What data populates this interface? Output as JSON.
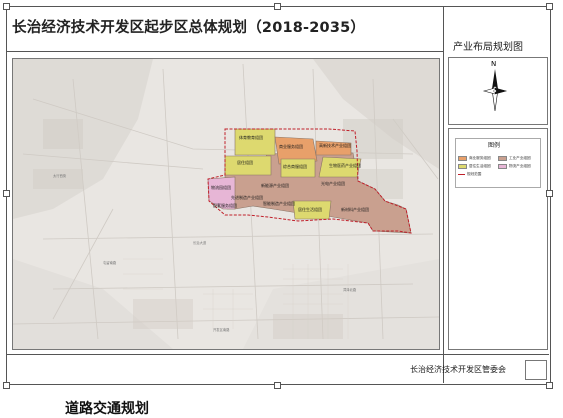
{
  "header": {
    "title": "长治经济技术开发区起步区总体规划（2018-2035）",
    "subtitle": "产业布局规划图"
  },
  "compass": {
    "north_label": "N",
    "icon": "north-arrow-icon"
  },
  "legend": {
    "title": "图例",
    "items": [
      {
        "label": "商业服务组团",
        "color": "#e8a06a"
      },
      {
        "label": "工业产业组团",
        "color": "#c9a08f"
      },
      {
        "label": "居住生活组团",
        "color": "#ddd96f"
      },
      {
        "label": "物流产业组团",
        "color": "#e7b6d6"
      },
      {
        "label": "规划范围",
        "color": "#c0202a",
        "style": "line"
      }
    ]
  },
  "map": {
    "zones": [
      {
        "label": "体育教育组团",
        "color": "#ddd96f"
      },
      {
        "label": "商业服务组团",
        "color": "#e8a06a"
      },
      {
        "label": "综合商服组团",
        "color": "#ddd96f"
      },
      {
        "label": "居住组团",
        "color": "#ddd96f"
      },
      {
        "label": "居住生活组团",
        "color": "#ddd96f"
      },
      {
        "label": "物流园组团",
        "color": "#e7b6d6"
      },
      {
        "label": "先进制造产业组团",
        "color": "#c9a08f"
      },
      {
        "label": "新能源产业组团",
        "color": "#c9a08f"
      },
      {
        "label": "光电产业组团",
        "color": "#c9a08f"
      },
      {
        "label": "智能制造产业组团",
        "color": "#c9a08f"
      },
      {
        "label": "新材料产业组团",
        "color": "#c9a08f"
      },
      {
        "label": "生物医药产业组团",
        "color": "#c9a08f"
      },
      {
        "label": "高新技术产业组团",
        "color": "#c9a08f"
      },
      {
        "label": "配套服务组团",
        "color": "#ddd96f"
      }
    ],
    "road_labels": [
      "太行西街",
      "长治大道",
      "屯留南路",
      "漳泽北路",
      "开发区南路"
    ]
  },
  "footer": {
    "organization": "长治经济技术开发区管委会"
  },
  "below_text": "道路交通规划"
}
